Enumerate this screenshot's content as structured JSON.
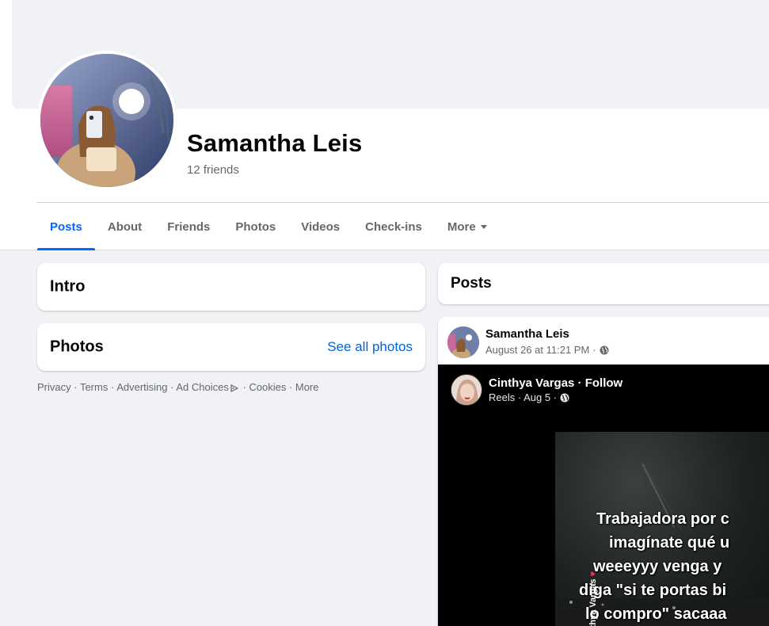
{
  "profile": {
    "name": "Samantha Leis",
    "friends": "12 friends"
  },
  "tabs": [
    {
      "label": "Posts",
      "active": true
    },
    {
      "label": "About"
    },
    {
      "label": "Friends"
    },
    {
      "label": "Photos"
    },
    {
      "label": "Videos"
    },
    {
      "label": "Check-ins"
    },
    {
      "label": "More"
    }
  ],
  "left": {
    "intro_title": "Intro",
    "photos_title": "Photos",
    "see_all": "See all photos",
    "footer": {
      "privacy": "Privacy",
      "terms": "Terms",
      "advertising": "Advertising",
      "ad_choices": "Ad Choices",
      "cookies": "Cookies",
      "more": "More",
      "sep": " · "
    }
  },
  "right": {
    "posts_title": "Posts",
    "post": {
      "author": "Samantha Leis",
      "time": "August 26 at 11:21 PM",
      "dot": "·",
      "shared": {
        "author": "Cinthya Vargas · Follow",
        "meta": "Reels · Aug 5 ·",
        "watermark": "Cinthya Vargas",
        "overlay_lines": [
          "Trabajadora por c",
          "imagínate qué u",
          "weeeyyy venga y",
          "diga \"si te portas bi",
          "lo compro\" sacaaa"
        ]
      }
    }
  },
  "colors": {
    "accent": "#0866ff",
    "link": "#0064d1",
    "muted": "#65676b",
    "page_bg": "#f0f2f5"
  }
}
